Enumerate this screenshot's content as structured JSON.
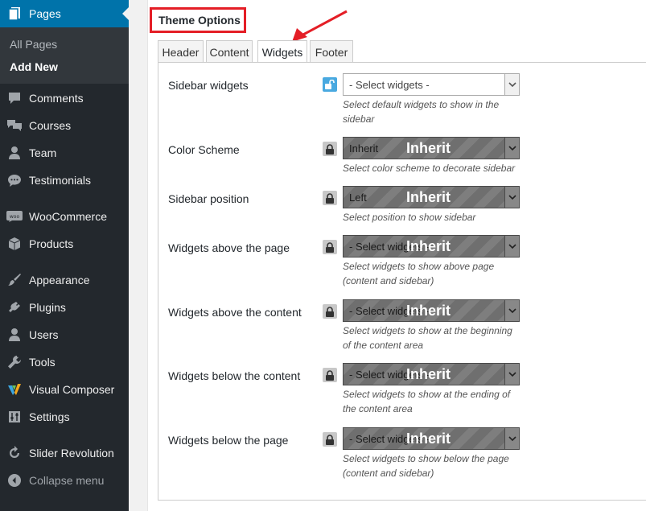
{
  "sidebar": {
    "pages": "Pages",
    "submenu": {
      "all_pages": "All Pages",
      "add_new": "Add New"
    },
    "items": [
      {
        "label": "Comments",
        "icon": "comment-icon"
      },
      {
        "label": "Courses",
        "icon": "courses-icon"
      },
      {
        "label": "Team",
        "icon": "user-icon"
      },
      {
        "label": "Testimonials",
        "icon": "testimonial-icon"
      },
      {
        "label": "WooCommerce",
        "icon": "woocommerce-icon"
      },
      {
        "label": "Products",
        "icon": "box-icon"
      },
      {
        "label": "Appearance",
        "icon": "brush-icon"
      },
      {
        "label": "Plugins",
        "icon": "plug-icon"
      },
      {
        "label": "Users",
        "icon": "user-icon"
      },
      {
        "label": "Tools",
        "icon": "wrench-icon"
      },
      {
        "label": "Visual Composer",
        "icon": "visual-composer-icon"
      },
      {
        "label": "Settings",
        "icon": "sliders-icon"
      },
      {
        "label": "Slider Revolution",
        "icon": "refresh-icon"
      }
    ],
    "collapse": "Collapse menu"
  },
  "theme_options": {
    "title": "Theme Options",
    "tabs": [
      "Header",
      "Content",
      "Widgets",
      "Footer"
    ],
    "active_tab": "Widgets",
    "inherit_label": "Inherit",
    "options": [
      {
        "label": "Sidebar widgets",
        "value": "- Select widgets -",
        "desc1": "Select default widgets to show in the",
        "desc2": "sidebar",
        "locked": false
      },
      {
        "label": "Color Scheme",
        "value": "Inherit",
        "desc1": "Select color scheme to decorate sidebar",
        "desc2": "",
        "locked": true
      },
      {
        "label": "Sidebar position",
        "value": "Left",
        "desc1": "Select position to show sidebar",
        "desc2": "",
        "locked": true
      },
      {
        "label": "Widgets above the page",
        "value": "- Select widgets -",
        "desc1": "Select widgets to show above page",
        "desc2": "(content and sidebar)",
        "locked": true
      },
      {
        "label": "Widgets above the content",
        "value": "- Select widgets -",
        "desc1": "Select widgets to show at the beginning",
        "desc2": "of the content area",
        "locked": true
      },
      {
        "label": "Widgets below the content",
        "value": "- Select widgets -",
        "desc1": "Select widgets to show at the ending of",
        "desc2": "the content area",
        "locked": true
      },
      {
        "label": "Widgets below the page",
        "value": "- Select widgets -",
        "desc1": "Select widgets to show below the page",
        "desc2": "(content and sidebar)",
        "locked": true
      }
    ]
  },
  "colors": {
    "sidebar_bg": "#23282d",
    "active_menu": "#0073aa",
    "highlight_red": "#e41e26",
    "unlock_blue": "#49a9e0"
  }
}
